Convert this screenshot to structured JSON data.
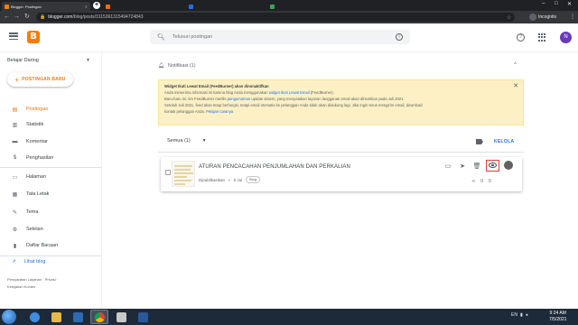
{
  "browser": {
    "tabs": [
      {
        "label": "Blogger: Postingan",
        "active": true
      },
      {
        "label": "",
        "active": false
      },
      {
        "label": "",
        "active": false
      },
      {
        "label": "",
        "active": false
      }
    ],
    "url_host": "blogger.com",
    "url_path": "/blog/posts/3115361315494724843",
    "profile_label": "Incognito"
  },
  "header": {
    "logo": "B",
    "search_placeholder": "Telusuri postingan",
    "avatar_initial": "N"
  },
  "sidebar": {
    "blog_name": "Belajar Daring",
    "new_post_label": "POSTINGAN BARU",
    "items": [
      {
        "label": "Postingan",
        "icon": "document-icon",
        "active": true
      },
      {
        "label": "Statistik",
        "icon": "bar-chart-icon",
        "active": false
      },
      {
        "label": "Komentar",
        "icon": "comment-icon",
        "active": false
      },
      {
        "label": "Penghasilan",
        "icon": "dollar-icon",
        "active": false
      },
      {
        "label": "Halaman",
        "icon": "page-icon",
        "active": false
      },
      {
        "label": "Tata Letak",
        "icon": "layout-icon",
        "active": false
      },
      {
        "label": "Tema",
        "icon": "brush-icon",
        "active": false
      },
      {
        "label": "Setelan",
        "icon": "gear-icon",
        "active": false
      },
      {
        "label": "Daftar Bacaan",
        "icon": "bookmark-icon",
        "active": false
      }
    ],
    "view_blog_label": "Lihat blog",
    "footer_links": [
      "Persyaratan Layanan",
      "Privasi",
      "Kebijakan Konten"
    ]
  },
  "notifications": {
    "header": "Notifikasi (1)",
    "banner": {
      "title": "Widget Ikuti Lewat Email (FeedBurner) akan dinonaktifkan",
      "line1_pre": "Anda menerima informasi ini karena blog Anda menggunakan ",
      "line1_link": "widget Ikuti Lewat Email",
      "line1_post": " (FeedBurner).",
      "line2_pre": "Baru-baru ini, tim FeedBurner merilis ",
      "line2_link": "pengumuman",
      "line2_post": " update sistem, yang menyatakan layanan langganan email akan dihentikan pada Juli 2021.",
      "line3": "Setelah Juli 2021, feed akan tetap berfungsi, tetapi email otomatis ke pelanggan Anda tidak akan didukung lagi. Jika ingin terus mengirim email, download",
      "line4_pre": "kontak pelanggan Anda. ",
      "line4_link": "Pelajari caranya"
    }
  },
  "posts_view": {
    "filter_label": "Semua (1)",
    "manage_label": "KELOLA",
    "posts": [
      {
        "title": "ATURAN PENCACAHAN PENJUMLAHAN DAN PERKALIAN",
        "status": "Dipublikasikan",
        "date": "5 Jul",
        "label_chip": "Blog",
        "comments": "0",
        "views": "0"
      }
    ]
  },
  "taskbar": {
    "language": "EN",
    "time": "9:24 AM",
    "date": "7/5/2021"
  }
}
